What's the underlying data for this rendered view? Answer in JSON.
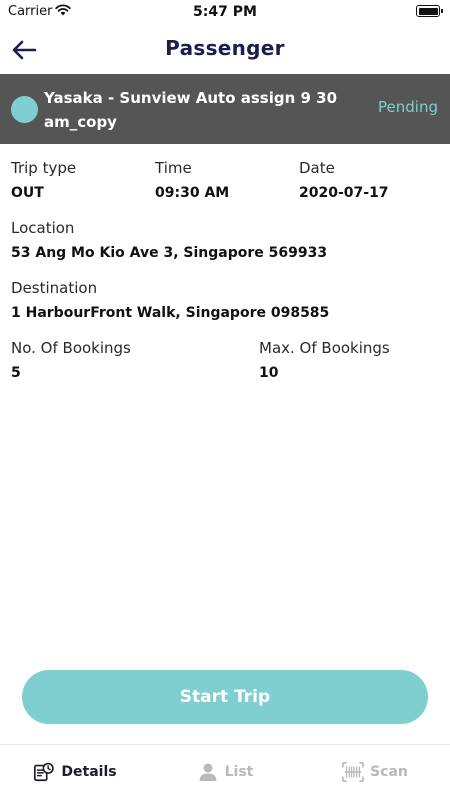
{
  "status_bar": {
    "carrier": "Carrier",
    "time": "5:47 PM"
  },
  "header": {
    "title": "Passenger"
  },
  "trip": {
    "name": "Yasaka - Sunview Auto assign 9 30 am_copy",
    "status": "Pending",
    "status_color": "#7fcfd1",
    "indicator_color": "#7fcfd1"
  },
  "details": {
    "trip_type": {
      "label": "Trip type",
      "value": "OUT"
    },
    "time": {
      "label": "Time",
      "value": "09:30 AM"
    },
    "date": {
      "label": "Date",
      "value": "2020-07-17"
    },
    "location": {
      "label": "Location",
      "value": "53 Ang Mo Kio Ave 3, Singapore 569933"
    },
    "destination": {
      "label": "Destination",
      "value": "1 HarbourFront Walk, Singapore 098585"
    },
    "bookings": {
      "label": "No. Of Bookings",
      "value": "5"
    },
    "max_bookings": {
      "label": "Max. Of Bookings",
      "value": "10"
    }
  },
  "actions": {
    "start_trip": "Start Trip",
    "accent": "#7fcfd1"
  },
  "tabs": [
    {
      "label": "Details",
      "icon": "details-icon",
      "active": true
    },
    {
      "label": "List",
      "icon": "person-icon",
      "active": false
    },
    {
      "label": "Scan",
      "icon": "barcode-icon",
      "active": false
    }
  ]
}
